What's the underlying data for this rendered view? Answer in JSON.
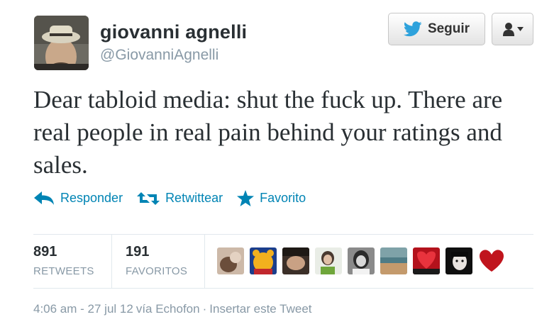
{
  "user": {
    "name": "giovanni agnelli",
    "handle": "@GiovanniAgnelli",
    "avatar_icon": "profile-photo"
  },
  "follow_button": {
    "label": "Seguir",
    "icon": "twitter-bird-icon"
  },
  "user_menu_button": {
    "icon": "person-icon"
  },
  "tweet": {
    "text": "Dear tabloid media: shut the fuck up. There are real people in real pain behind your ratings and sales."
  },
  "actions": {
    "reply": "Responder",
    "retweet": "Retwittear",
    "favorite": "Favorito"
  },
  "stats": {
    "retweets": {
      "count": "891",
      "label": "RETWEETS"
    },
    "favorites": {
      "count": "191",
      "label": "FAVORITOS"
    }
  },
  "favoriters": [
    {
      "name": "favoriter-avatar-1"
    },
    {
      "name": "favoriter-avatar-2"
    },
    {
      "name": "favoriter-avatar-3"
    },
    {
      "name": "favoriter-avatar-4"
    },
    {
      "name": "favoriter-avatar-5"
    },
    {
      "name": "favoriter-avatar-6"
    },
    {
      "name": "favoriter-avatar-7"
    },
    {
      "name": "favoriter-avatar-8"
    },
    {
      "name": "favoriter-avatar-9"
    }
  ],
  "footer": {
    "timestamp": "4:06 am - 27 jul 12",
    "via": "vía Echofon",
    "separator": "·",
    "embed": "Insertar este Tweet"
  },
  "colors": {
    "link": "#0084b4",
    "twitter_blue": "#2ea2dc",
    "muted": "#8899a6"
  }
}
